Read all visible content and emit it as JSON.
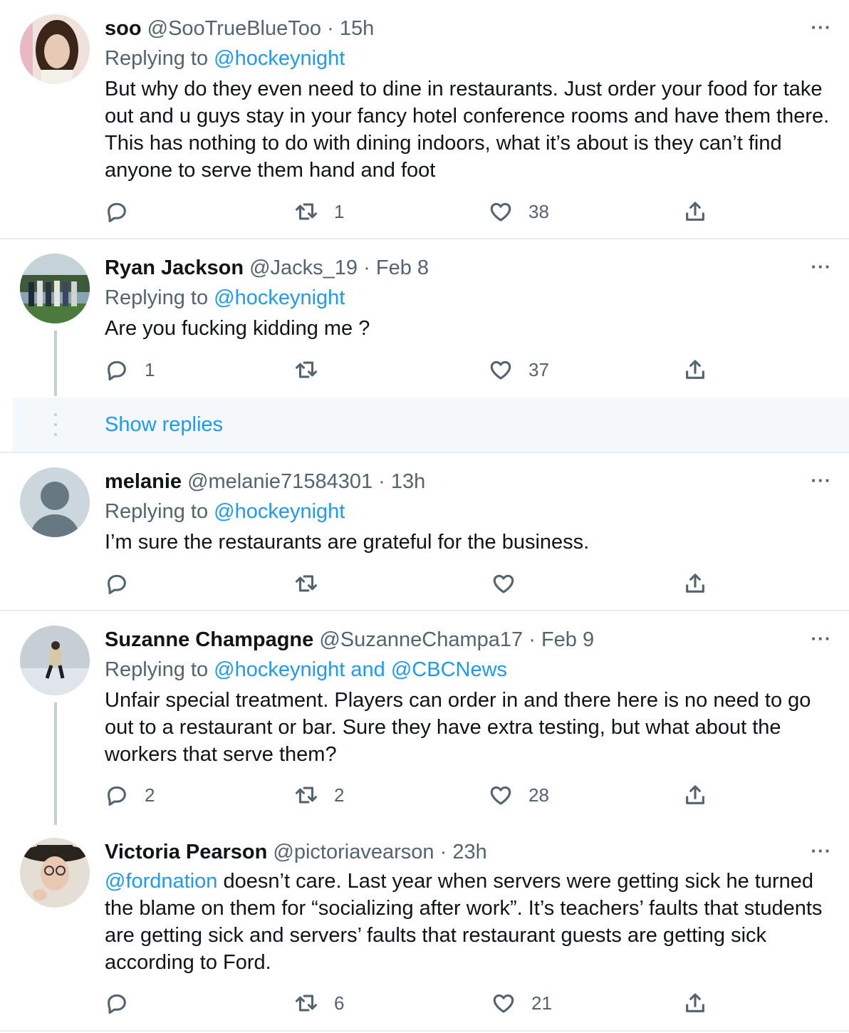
{
  "tweets": [
    {
      "name": "soo",
      "handle": "@SooTrueBlueToo",
      "separator": "·",
      "time": "15h",
      "replying_prefix": "Replying to ",
      "replying_to": "@hockeynight",
      "text": "But why do they even need to dine in restaurants. Just order your food for take out and u guys stay in your fancy hotel conference rooms and have them there. This has nothing to do with dining indoors, what it’s about is they can’t find anyone to serve them hand and foot",
      "replies": "",
      "retweets": "1",
      "likes": "38",
      "avatar_colors": [
        "#e8c9b5",
        "#3b2418"
      ]
    },
    {
      "name": "Ryan Jackson",
      "handle": "@Jacks_19",
      "separator": "·",
      "time": "Feb 8",
      "replying_prefix": "Replying to ",
      "replying_to": "@hockeynight",
      "text": "Are you fucking kidding me ?",
      "replies": "1",
      "retweets": "",
      "likes": "37",
      "avatar_colors": [
        "#7f9a86",
        "#2e3d2a"
      ]
    },
    {
      "name": "melanie",
      "handle": "@melanie71584301",
      "separator": "·",
      "time": "13h",
      "replying_prefix": "Replying to ",
      "replying_to": "@hockeynight",
      "text": "I’m sure the restaurants are grateful for the business.",
      "replies": "",
      "retweets": "",
      "likes": "",
      "avatar_colors": [
        "#ccd6dd",
        "#687883"
      ]
    },
    {
      "name": "Suzanne Champagne",
      "handle": "@SuzanneChampa17",
      "separator": "·",
      "time": "Feb 9",
      "replying_prefix": "Replying to ",
      "replying_to": "@hockeynight and @CBCNews",
      "text": "Unfair special treatment. Players can order in and there here is no need to go out to a restaurant or bar.  Sure they have extra testing, but what about the workers that serve them?",
      "replies": "2",
      "retweets": "2",
      "likes": "28",
      "avatar_colors": [
        "#c9d2d8",
        "#3a3a3a"
      ]
    },
    {
      "name": "Victoria Pearson",
      "handle": "@pictoriavearson",
      "separator": "·",
      "time": "23h",
      "mention": "@fordnation",
      "text": " doesn’t care. Last year when servers were getting sick he turned the blame on them for “socializing after work”. It’s teachers’ faults that students are getting sick and servers’ faults that restaurant guests are getting sick according to Ford.",
      "replies": "",
      "retweets": "6",
      "likes": "21",
      "avatar_colors": [
        "#d8d2c8",
        "#2a2420"
      ]
    }
  ],
  "show_replies": "Show replies",
  "more_glyph": "···",
  "colors": {
    "link": "#1d9bf0",
    "muted": "#536471",
    "text": "#0f1419",
    "divider": "#e6ecf0"
  }
}
